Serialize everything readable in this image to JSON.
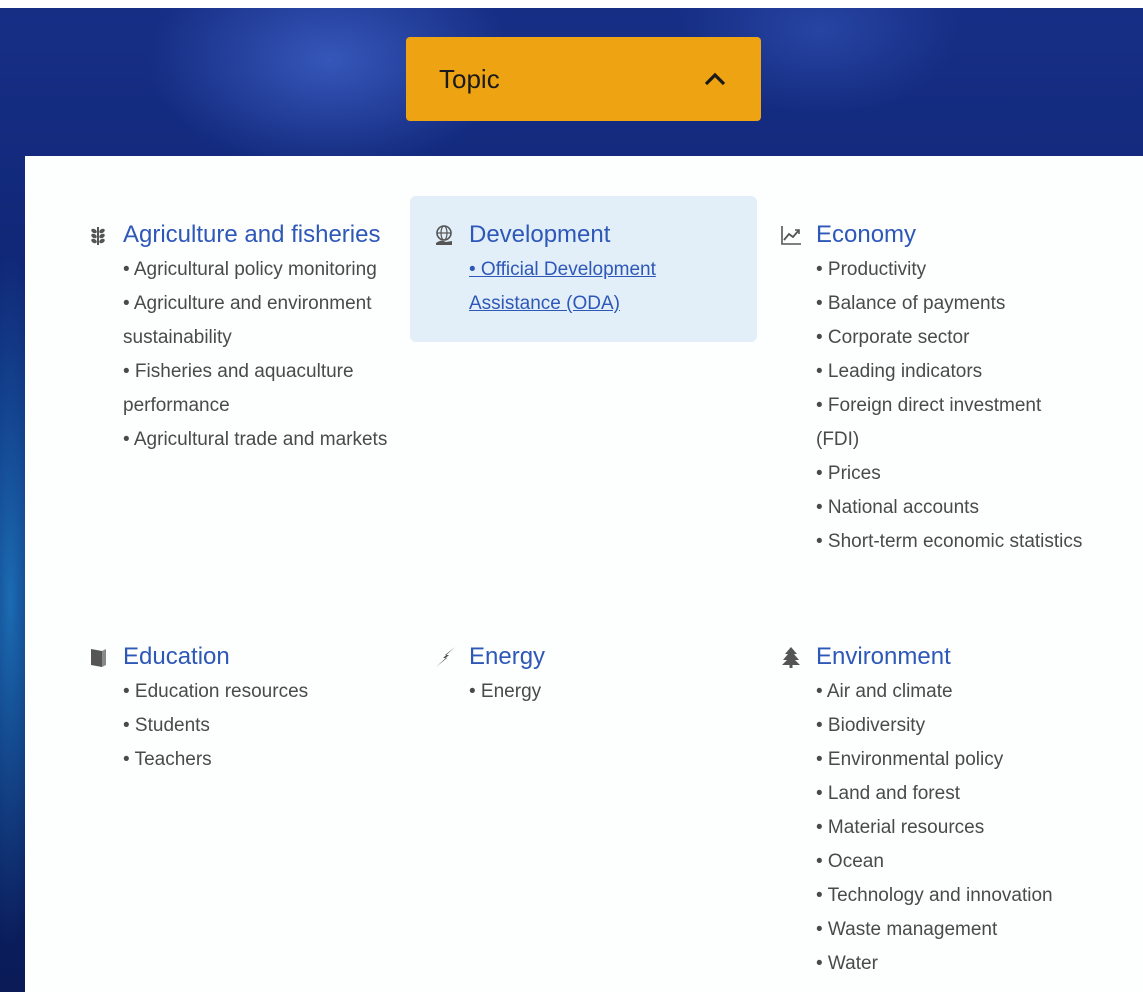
{
  "header": {
    "topic_button_label": "Topic"
  },
  "categories": [
    {
      "title": "Agriculture and fisheries",
      "icon": "wheat-icon",
      "items": [
        "• Agricultural policy monitoring",
        "• Agriculture and environment sustainability",
        "• Fisheries and aquaculture performance",
        "• Agricultural trade and markets"
      ]
    },
    {
      "title": "Development",
      "icon": "globe-hand-icon",
      "items": [
        "• Official Development Assistance (ODA)"
      ]
    },
    {
      "title": "Economy",
      "icon": "line-chart-icon",
      "items": [
        "• Productivity",
        "• Balance of payments",
        "• Corporate sector",
        "• Leading indicators",
        "• Foreign direct investment (FDI)",
        "• Prices",
        "• National accounts",
        "• Short-term economic statistics"
      ]
    },
    {
      "title": "Education",
      "icon": "book-icon",
      "items": [
        "• Education resources",
        "• Students",
        "• Teachers"
      ]
    },
    {
      "title": "Energy",
      "icon": "lightning-icon",
      "items": [
        "• Energy"
      ]
    },
    {
      "title": "Environment",
      "icon": "tree-icon",
      "items": [
        "• Air and climate",
        "• Biodiversity",
        "• Environmental policy",
        "• Land and forest",
        "• Material resources",
        "• Ocean",
        "• Technology and innovation",
        "• Waste management",
        "• Water"
      ]
    }
  ],
  "colors": {
    "accent": "#eea313",
    "link": "#2e58b8",
    "highlight": "#e3eff8"
  }
}
